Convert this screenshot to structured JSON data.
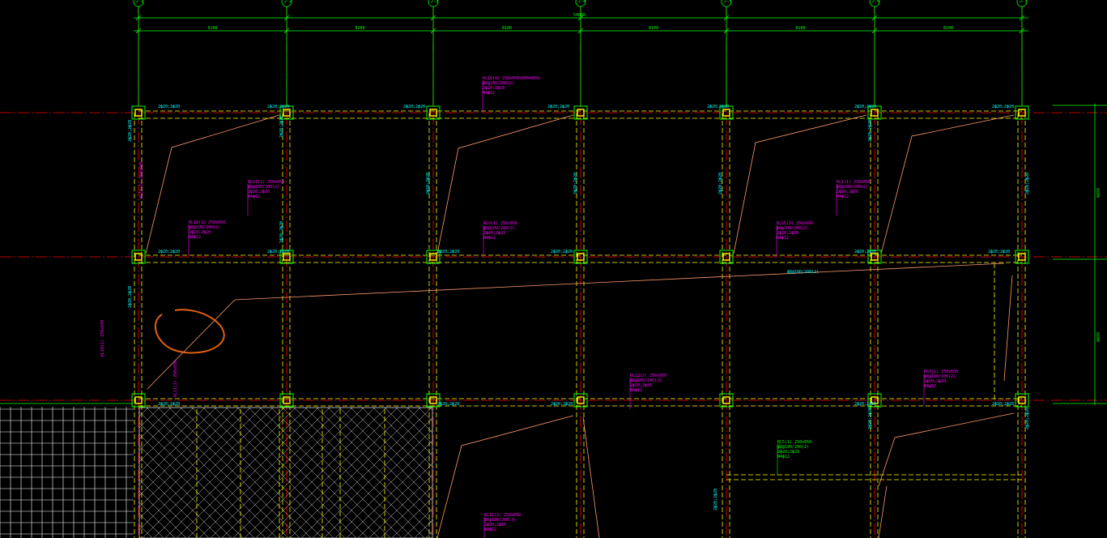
{
  "colors": {
    "background": "#000000",
    "axis_line": "#ff0000",
    "dimension": "#00ff00",
    "beam_dashed": "#ffff00",
    "column": "#ffff00",
    "column_outline": "#00ff00",
    "slab_line": "#ff9a6a",
    "annotation_magenta": "#ff00ff",
    "annotation_cyan": "#00ffff",
    "annotation_green": "#00ff00",
    "markup_circle": "#e06010",
    "hatch": "#d0d0d0"
  },
  "axis_bubbles": [
    "2-1",
    "2-2",
    "2-3",
    "2-4",
    "2-5",
    "2-6",
    "2-7"
  ],
  "dimension_labels": [
    "9100",
    "8100",
    "8100",
    "8100",
    "8100",
    "8100"
  ],
  "overall_dimension": "54600",
  "row_dimensions": [
    "6600",
    "6600"
  ],
  "beam_annotations": [
    "KL16(4) 250x650(600x850)",
    "KL10(1) 250x650",
    "KL9(1) 250x650",
    "KL15(2) 250x650",
    "KL11(1) 250x650",
    "KL1(1) 250x650",
    "KL13(2) 250x650",
    "KL6(1) 250x650",
    "KL5(1) 250x650",
    "KL11(2) 250x650"
  ],
  "beam_notes": [
    "ф8@100/200(2)",
    "2ф20;2ф20",
    "N4ф12"
  ],
  "markup": {
    "circle": true
  }
}
